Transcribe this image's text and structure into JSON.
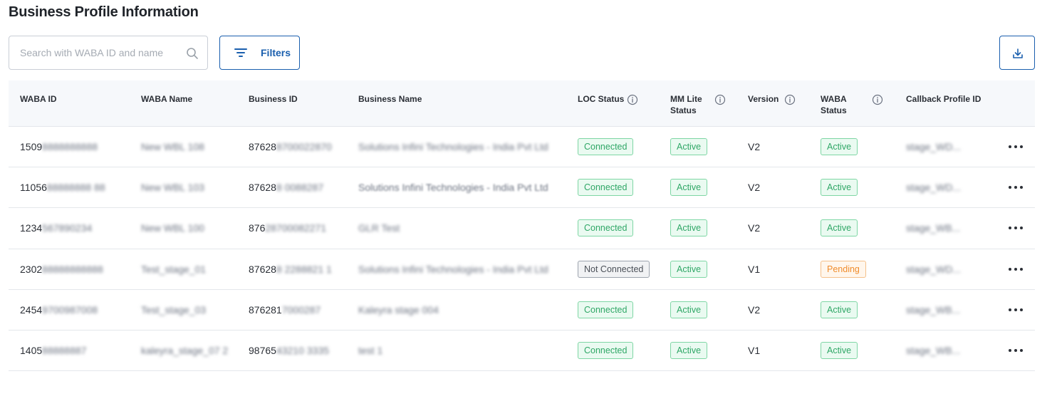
{
  "page": {
    "title": "Business Profile Information"
  },
  "toolbar": {
    "search_placeholder": "Search with WABA ID and name",
    "search_value": "",
    "filters_label": "Filters"
  },
  "table": {
    "headers": {
      "waba_id": "WABA ID",
      "waba_name": "WABA Name",
      "business_id": "Business ID",
      "business_name": "Business Name",
      "loc_status": "LOC Status",
      "mm_lite_status_1": "MM Lite",
      "mm_lite_status_2": "Status",
      "version": "Version",
      "waba_status_1": "WABA",
      "waba_status_2": "Status",
      "callback_profile_id": "Callback Profile ID"
    },
    "rows": [
      {
        "waba_id_visible": "1509",
        "waba_id_masked": "8888888888",
        "waba_name": "New WBL 108",
        "business_id_visible": "87628",
        "business_id_masked": "8700022870",
        "business_name": "Solutions Infini Technologies - India Pvt Ltd",
        "loc_status": "Connected",
        "loc_status_type": "green",
        "mm_lite_status": "Active",
        "mm_lite_type": "green",
        "version": "V2",
        "waba_status": "Active",
        "waba_status_type": "green",
        "callback": "stage_WD..."
      },
      {
        "waba_id_visible": "11056",
        "waba_id_masked": "88888888 88",
        "waba_name": "New WBL 103",
        "business_id_visible": "87628",
        "business_id_masked": "8 0088287",
        "business_name": "Solutions Infini Technologies - India Pvt Ltd",
        "loc_status": "Connected",
        "loc_status_type": "green",
        "mm_lite_status": "Active",
        "mm_lite_type": "green",
        "version": "V2",
        "waba_status": "Active",
        "waba_status_type": "green",
        "callback": "stage_WD..."
      },
      {
        "waba_id_visible": "1234",
        "waba_id_masked": "567890234",
        "waba_name": "New WBL 100",
        "business_id_visible": "876",
        "business_id_masked": "28700082271",
        "business_name": "GLR Test",
        "loc_status": "Connected",
        "loc_status_type": "green",
        "mm_lite_status": "Active",
        "mm_lite_type": "green",
        "version": "V2",
        "waba_status": "Active",
        "waba_status_type": "green",
        "callback": "stage_WB..."
      },
      {
        "waba_id_visible": "2302",
        "waba_id_masked": "88888888888",
        "waba_name": "Test_stage_01",
        "business_id_visible": "87628",
        "business_id_masked": "8 2288821 1",
        "business_name": "Solutions Infini Technologies - India Pvt Ltd",
        "loc_status": "Not Connected",
        "loc_status_type": "grey",
        "mm_lite_status": "Active",
        "mm_lite_type": "green",
        "version": "V1",
        "waba_status": "Pending",
        "waba_status_type": "orange",
        "callback": "stage_WD..."
      },
      {
        "waba_id_visible": "2454",
        "waba_id_masked": "9700987008",
        "waba_name": "Test_stage_03",
        "business_id_visible": "876281",
        "business_id_masked": "7000287",
        "business_name": "Kaleyra stage 004",
        "loc_status": "Connected",
        "loc_status_type": "green",
        "mm_lite_status": "Active",
        "mm_lite_type": "green",
        "version": "V2",
        "waba_status": "Active",
        "waba_status_type": "green",
        "callback": "stage_WB..."
      },
      {
        "waba_id_visible": "1405",
        "waba_id_masked": "88888887",
        "waba_name": "kaleyra_stage_07 2",
        "business_id_visible": "98765",
        "business_id_masked": "43210 3335",
        "business_name": "test 1",
        "loc_status": "Connected",
        "loc_status_type": "green",
        "mm_lite_status": "Active",
        "mm_lite_type": "green",
        "version": "V1",
        "waba_status": "Active",
        "waba_status_type": "green",
        "callback": "stage_WB..."
      }
    ]
  },
  "colors": {
    "accent": "#1a5fae",
    "success": "#2fa766",
    "warning": "#f08c2c",
    "neutral": "#4b5058"
  },
  "icons": {
    "search": "search-icon",
    "filter": "filter-icon",
    "download": "download-icon",
    "info": "info-icon",
    "more": "more-horizontal-icon"
  }
}
